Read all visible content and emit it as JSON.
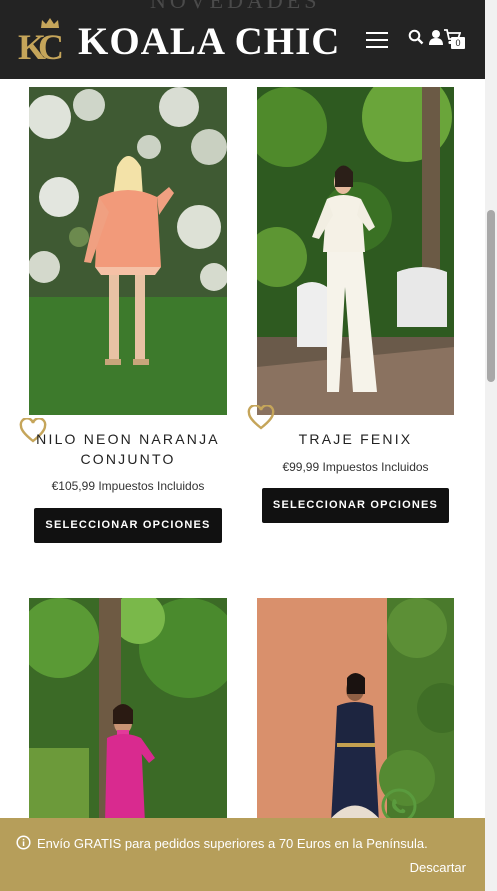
{
  "header": {
    "ghost_heading": "NOVEDADES",
    "logo_mark": "KC",
    "logo_text": "KOALA CHIC",
    "cart_count": "0"
  },
  "products": [
    {
      "title_line1": "NILO NEON NARANJA",
      "title_line2": "CONJUNTO",
      "price": "€105,99 Impuestos Incluidos",
      "button": "SELECCIONAR OPCIONES"
    },
    {
      "title_line1": "TRAJE FENIX",
      "price": "€99,99 Impuestos Incluidos",
      "button": "SELECCIONAR OPCIONES"
    }
  ],
  "notice": {
    "text": "Envío GRATIS para pedidos superiores a 70 Euros en la Península.",
    "dismiss": "Descartar"
  },
  "colors": {
    "header_bg": "#232323",
    "brand_gold": "#c5a55a",
    "notice_bg": "#b69e5a",
    "button_bg": "#111111"
  },
  "icons": [
    "crown-icon",
    "menu-icon",
    "search-icon",
    "account-icon",
    "cart-icon",
    "heart-icon",
    "info-icon",
    "whatsapp-icon"
  ]
}
